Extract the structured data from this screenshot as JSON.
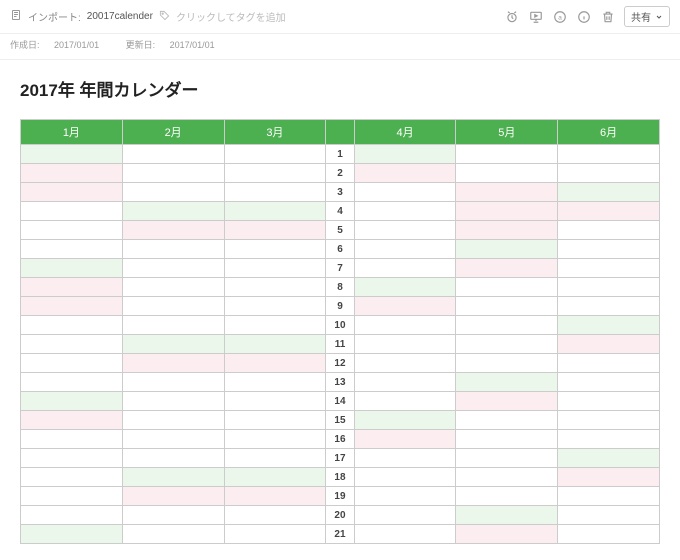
{
  "topbar": {
    "import_label": "インポート:",
    "note_title": "20017calender",
    "tag_placeholder": "クリックしてタグを追加",
    "share_label": "共有"
  },
  "meta": {
    "created_label": "作成日:",
    "created_value": "2017/01/01",
    "updated_label": "更新日:",
    "updated_value": "2017/01/01"
  },
  "document": {
    "title": "2017年 年間カレンダー"
  },
  "calendar": {
    "months": [
      "1月",
      "2月",
      "3月",
      "4月",
      "5月",
      "6月"
    ],
    "rows": [
      {
        "d": 1,
        "c": [
          "green",
          "",
          "",
          "green",
          "",
          ""
        ]
      },
      {
        "d": 2,
        "c": [
          "pink",
          "",
          "",
          "pink",
          "",
          ""
        ]
      },
      {
        "d": 3,
        "c": [
          "pink",
          "",
          "",
          "",
          "pink",
          "green"
        ]
      },
      {
        "d": 4,
        "c": [
          "",
          "green",
          "green",
          "",
          "pink",
          "pink"
        ]
      },
      {
        "d": 5,
        "c": [
          "",
          "pink",
          "pink",
          "",
          "pink",
          ""
        ]
      },
      {
        "d": 6,
        "c": [
          "",
          "",
          "",
          "",
          "green",
          ""
        ]
      },
      {
        "d": 7,
        "c": [
          "green",
          "",
          "",
          "",
          "pink",
          ""
        ]
      },
      {
        "d": 8,
        "c": [
          "pink",
          "",
          "",
          "green",
          "",
          ""
        ]
      },
      {
        "d": 9,
        "c": [
          "pink",
          "",
          "",
          "pink",
          "",
          ""
        ]
      },
      {
        "d": 10,
        "c": [
          "",
          "",
          "",
          "",
          "",
          "green"
        ]
      },
      {
        "d": 11,
        "c": [
          "",
          "green",
          "green",
          "",
          "",
          "pink"
        ]
      },
      {
        "d": 12,
        "c": [
          "",
          "pink",
          "pink",
          "",
          "",
          ""
        ]
      },
      {
        "d": 13,
        "c": [
          "",
          "",
          "",
          "",
          "green",
          ""
        ]
      },
      {
        "d": 14,
        "c": [
          "green",
          "",
          "",
          "",
          "pink",
          ""
        ]
      },
      {
        "d": 15,
        "c": [
          "pink",
          "",
          "",
          "green",
          "",
          ""
        ]
      },
      {
        "d": 16,
        "c": [
          "",
          "",
          "",
          "pink",
          "",
          ""
        ]
      },
      {
        "d": 17,
        "c": [
          "",
          "",
          "",
          "",
          "",
          "green"
        ]
      },
      {
        "d": 18,
        "c": [
          "",
          "green",
          "green",
          "",
          "",
          "pink"
        ]
      },
      {
        "d": 19,
        "c": [
          "",
          "pink",
          "pink",
          "",
          "",
          ""
        ]
      },
      {
        "d": 20,
        "c": [
          "",
          "",
          "",
          "",
          "green",
          ""
        ]
      },
      {
        "d": 21,
        "c": [
          "green",
          "",
          "",
          "",
          "pink",
          ""
        ]
      }
    ]
  }
}
